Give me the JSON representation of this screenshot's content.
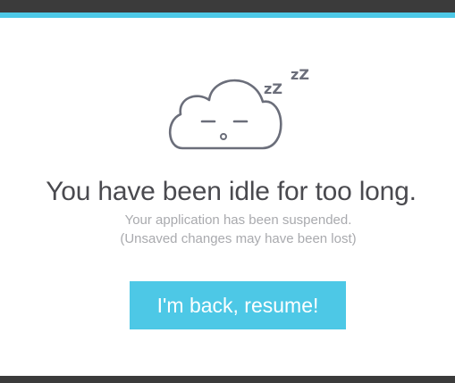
{
  "colors": {
    "header": "#3b3b3b",
    "accent": "#4dc8e6",
    "icon": "#6b6e7a",
    "headline": "#4a4a4f",
    "subtext": "#a9aaae",
    "button_text": "#ffffff"
  },
  "illustration": {
    "icon": "sleeping-cloud-icon",
    "snore_small": "zZ",
    "snore_large": "zZ"
  },
  "message": {
    "headline": "You have been idle for too long.",
    "line1": "Your application has been suspended.",
    "line2": "(Unsaved changes may have been lost)"
  },
  "actions": {
    "resume_label": "I'm back, resume!"
  }
}
